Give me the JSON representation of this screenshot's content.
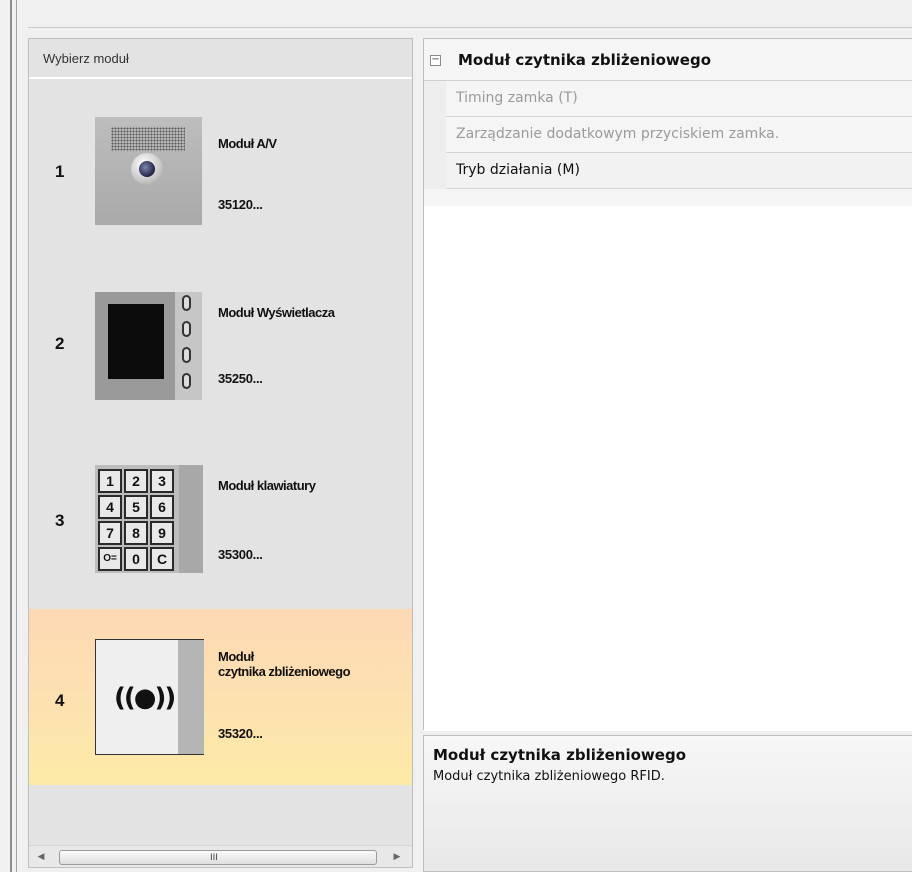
{
  "left_panel": {
    "header": "Wybierz moduł",
    "modules": [
      {
        "number": "1",
        "name": "Moduł A/V",
        "code": "35120..."
      },
      {
        "number": "2",
        "name": "Moduł Wyświetlacza",
        "code": "35250..."
      },
      {
        "number": "3",
        "name": "Moduł klawiatury",
        "code": "35300..."
      },
      {
        "number": "4",
        "name_line1": "Moduł",
        "name_line2": "czytnika zbliżeniowego",
        "code": "35320..."
      }
    ],
    "keypad_keys": [
      "1",
      "2",
      "3",
      "4",
      "5",
      "6",
      "7",
      "8",
      "9",
      "O=",
      "0",
      "C"
    ],
    "rfid_symbol": "((●))",
    "scrollbar": {
      "left_arrow": "◀",
      "right_arrow": "▶",
      "grip": "III"
    }
  },
  "property_grid": {
    "collapse_symbol": "⊟",
    "category": "Moduł czytnika zbliżeniowego",
    "properties": [
      {
        "label": "Timing zamka (T)",
        "enabled": false
      },
      {
        "label": "Zarządzanie dodatkowym przyciskiem zamka.",
        "enabled": false
      },
      {
        "label": "Tryb działania (M)",
        "enabled": true
      }
    ]
  },
  "description": {
    "title": "Moduł czytnika zbliżeniowego",
    "text": "Moduł czytnika zbliżeniowego RFID."
  },
  "colors": {
    "selected_gradient_top": "#fdd8b4",
    "selected_gradient_bottom": "#fdeaa6",
    "panel_bg": "#e3e3e3"
  }
}
